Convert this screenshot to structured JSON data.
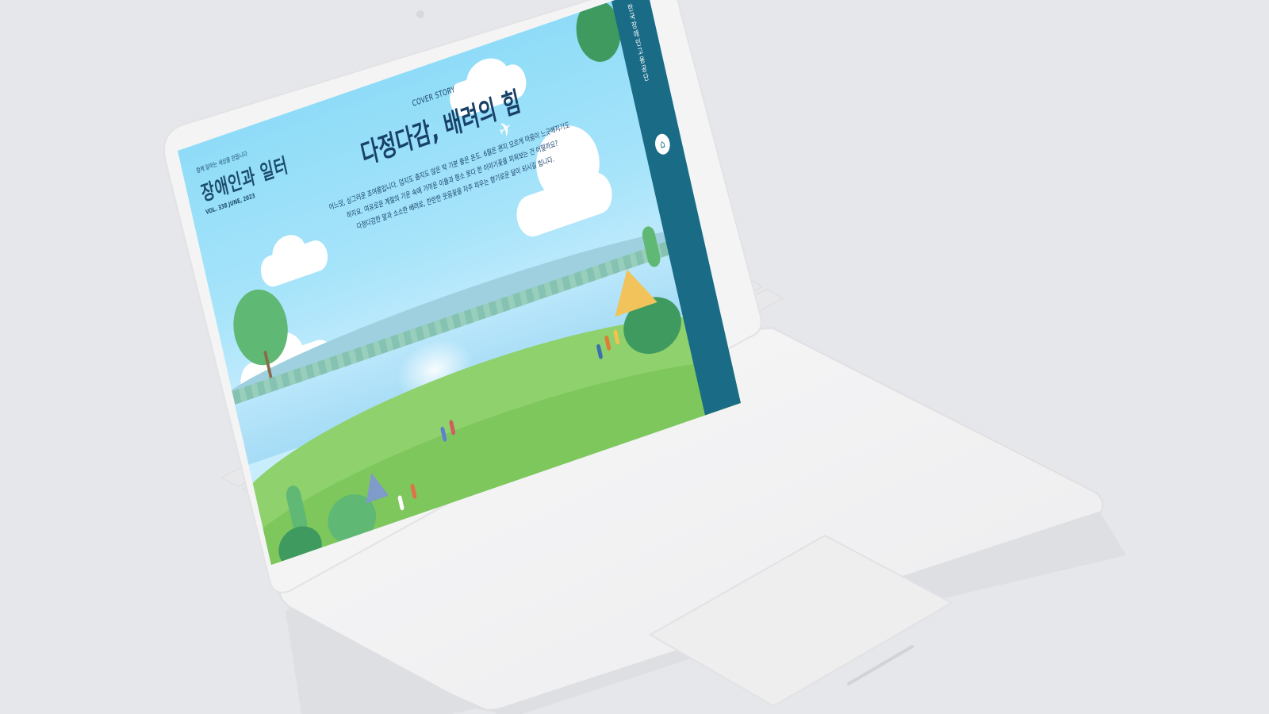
{
  "screen": {
    "masthead": {
      "tagline": "함께 일하는 세상을 만듭니다",
      "title": "장애인과 일터",
      "issue": "VOL. 338 JUNE, 2023"
    },
    "cover": {
      "kicker": "COVER STORY",
      "headline": "다정다감, 배려의 힘",
      "body_lines": [
        "어느덧, 싱그러운 초여름입니다. 덥지도 춥지도 않은 딱 기분 좋은 온도. 6월은 괜지 모르게 마음이 느긋해지기도",
        "하지요. 여유로운 계절의 기운 속에 가까운 이들과 평소 못다 한 이야기꽃을 피워보는 건 어떨까요?",
        "다정다감한 말과 소소한 배려로, 찬란한 웃음꽃을 자주 피우는 향기로운 달이 되시길 빕니다."
      ]
    },
    "sidebar": {
      "label": "한국장애인고용공단",
      "home_icon": "home-icon"
    }
  },
  "colors": {
    "sky": "#8fdcf8",
    "sidebar": "#1a6b86",
    "headline": "#18416a",
    "meadow": "#8ed16d",
    "background": "#e6e7eb",
    "laptop": "#f3f3f4"
  }
}
